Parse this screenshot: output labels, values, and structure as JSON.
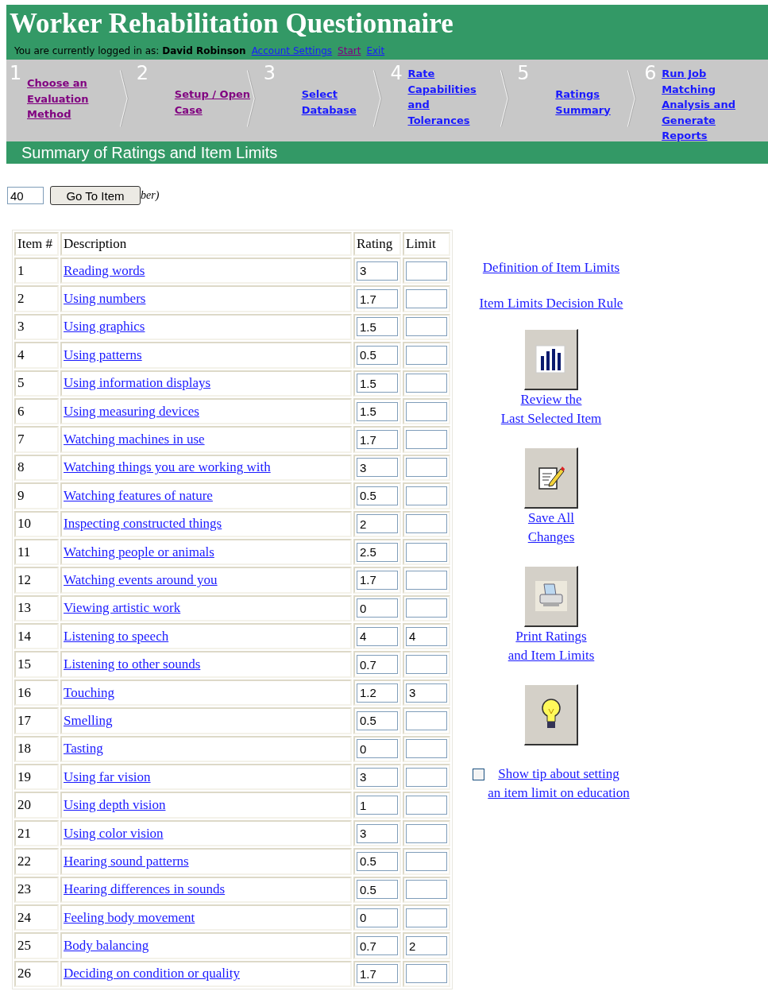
{
  "header": {
    "title": "Worker Rehabilitation Questionnaire",
    "login_text": "You are currently logged in as:",
    "user": "David Robinson",
    "links": [
      {
        "label": "Account Settings",
        "visited": false
      },
      {
        "label": "Start",
        "visited": true
      },
      {
        "label": "Exit",
        "visited": false
      }
    ]
  },
  "steps": [
    {
      "number": "1",
      "label": "Choose an Evaluation Method",
      "visited": true
    },
    {
      "number": "2",
      "label": "Setup / Open Case",
      "visited": true
    },
    {
      "number": "3",
      "label": "Select Database",
      "visited": false
    },
    {
      "number": "4",
      "label": "Rate Capabilities and Tolerances",
      "visited": false
    },
    {
      "number": "5",
      "label": "Ratings Summary",
      "visited": false
    },
    {
      "number": "6",
      "label": "Run Job Matching Analysis and Generate Reports",
      "visited": false
    }
  ],
  "section_title": "Summary of Ratings and Item Limits",
  "goto": {
    "value": "40",
    "button": "Go To Item",
    "hint": "ber)"
  },
  "table": {
    "columns": [
      "Item #",
      "Description",
      "Rating",
      "Limit"
    ],
    "rows": [
      {
        "item": "1",
        "description": "Reading words",
        "rating": "3",
        "limit": ""
      },
      {
        "item": "2",
        "description": "Using numbers",
        "rating": "1.7",
        "limit": ""
      },
      {
        "item": "3",
        "description": "Using graphics",
        "rating": "1.5",
        "limit": ""
      },
      {
        "item": "4",
        "description": "Using patterns",
        "rating": "0.5",
        "limit": ""
      },
      {
        "item": "5",
        "description": "Using information displays",
        "rating": "1.5",
        "limit": ""
      },
      {
        "item": "6",
        "description": "Using measuring devices",
        "rating": "1.5",
        "limit": ""
      },
      {
        "item": "7",
        "description": "Watching machines in use",
        "rating": "1.7",
        "limit": ""
      },
      {
        "item": "8",
        "description": "Watching things you are working with",
        "rating": "3",
        "limit": ""
      },
      {
        "item": "9",
        "description": "Watching features of nature",
        "rating": "0.5",
        "limit": ""
      },
      {
        "item": "10",
        "description": "Inspecting constructed things",
        "rating": "2",
        "limit": ""
      },
      {
        "item": "11",
        "description": "Watching people or animals",
        "rating": "2.5",
        "limit": ""
      },
      {
        "item": "12",
        "description": "Watching events around you",
        "rating": "1.7",
        "limit": ""
      },
      {
        "item": "13",
        "description": "Viewing artistic work",
        "rating": "0",
        "limit": ""
      },
      {
        "item": "14",
        "description": "Listening to speech",
        "rating": "4",
        "limit": "4"
      },
      {
        "item": "15",
        "description": "Listening to other sounds",
        "rating": "0.7",
        "limit": ""
      },
      {
        "item": "16",
        "description": "Touching",
        "rating": "1.2",
        "limit": "3"
      },
      {
        "item": "17",
        "description": "Smelling",
        "rating": "0.5",
        "limit": ""
      },
      {
        "item": "18",
        "description": "Tasting",
        "rating": "0",
        "limit": ""
      },
      {
        "item": "19",
        "description": "Using far vision",
        "rating": "3",
        "limit": ""
      },
      {
        "item": "20",
        "description": "Using depth vision",
        "rating": "1",
        "limit": ""
      },
      {
        "item": "21",
        "description": "Using color vision",
        "rating": "3",
        "limit": ""
      },
      {
        "item": "22",
        "description": "Hearing sound patterns",
        "rating": "0.5",
        "limit": ""
      },
      {
        "item": "23",
        "description": "Hearing differences in sounds",
        "rating": "0.5",
        "limit": ""
      },
      {
        "item": "24",
        "description": "Feeling body movement",
        "rating": "0",
        "limit": ""
      },
      {
        "item": "25",
        "description": "Body balancing",
        "rating": "0.7",
        "limit": "2"
      },
      {
        "item": "26",
        "description": "Deciding on condition or quality",
        "rating": "1.7",
        "limit": ""
      }
    ]
  },
  "side": {
    "links": [
      "Definition of Item Limits",
      "Item Limits Decision Rule"
    ],
    "actions": [
      {
        "kind": "chart",
        "label_lines": [
          "Review the",
          "Last Selected Item"
        ]
      },
      {
        "kind": "edit",
        "label_lines": [
          "Save All",
          "Changes"
        ]
      },
      {
        "kind": "print",
        "label_lines": [
          "Print Ratings",
          "and Item Limits"
        ]
      },
      {
        "kind": "tip"
      }
    ],
    "tip_checkbox": {
      "checked": false,
      "label_lines": [
        "Show tip about setting",
        "an item limit on education"
      ]
    }
  }
}
